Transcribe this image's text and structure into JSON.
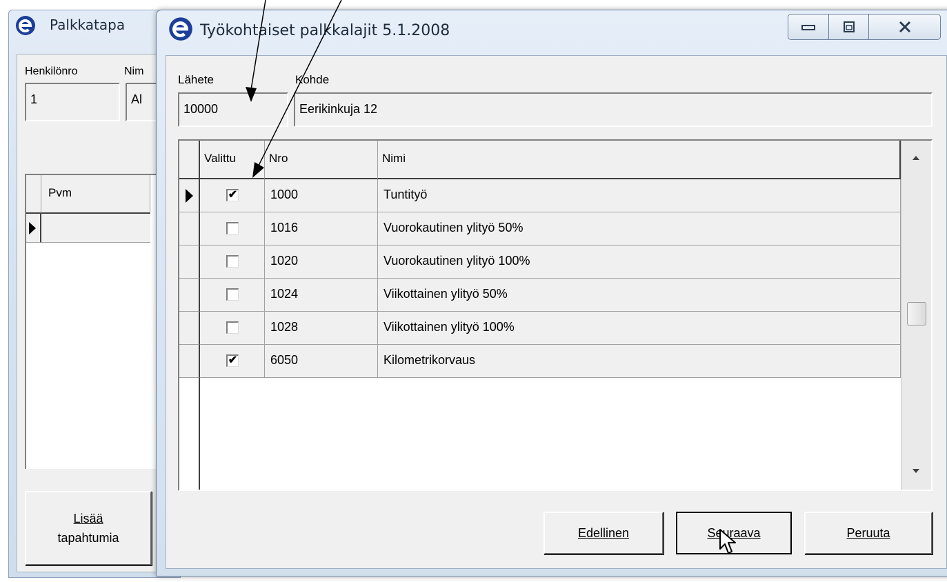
{
  "background_window": {
    "title": "Palkkatapa",
    "label_henkilonro": "Henkilönro",
    "label_nimi": "Nim",
    "henkilonro_value": "1",
    "nimi_value": "Al",
    "grid_header_pvm": "Pvm",
    "add_button_label_1": "Lisää",
    "add_button_label_2": "tapahtumia"
  },
  "dialog": {
    "title": "Työkohtaiset palkkalajit 5.1.2008",
    "label_lahete": "Lähete",
    "label_kohde": "Kohde",
    "lahete_value": "10000",
    "kohde_value": "Eerikinkuja 12",
    "columns": {
      "valittu": "Valittu",
      "nro": "Nro",
      "nimi": "Nimi"
    },
    "rows": [
      {
        "valittu": true,
        "nro": "1000",
        "nimi": "Tuntityö"
      },
      {
        "valittu": false,
        "nro": "1016",
        "nimi": "Vuorokautinen ylityö 50%"
      },
      {
        "valittu": false,
        "nro": "1020",
        "nimi": "Vuorokautinen ylityö 100%"
      },
      {
        "valittu": false,
        "nro": "1024",
        "nimi": "Viikottainen ylityö 50%"
      },
      {
        "valittu": false,
        "nro": "1028",
        "nimi": "Viikottainen ylityö 100%"
      },
      {
        "valittu": true,
        "nro": "6050",
        "nimi": "Kilometrikorvaus"
      }
    ],
    "buttons": {
      "previous": "Edellinen",
      "next": "Seuraava",
      "cancel": "Peruuta"
    }
  },
  "colors": {
    "logo": "#1d3f9a",
    "title_bar": "#d9e5f2",
    "face": "#f0f0f0"
  },
  "icons": [
    "e-logo-icon",
    "minimize-icon",
    "maximize-icon",
    "close-icon",
    "row-pointer-icon",
    "scroll-up-icon",
    "scroll-down-icon",
    "mouse-cursor-icon",
    "annotation-arrow-icon"
  ]
}
